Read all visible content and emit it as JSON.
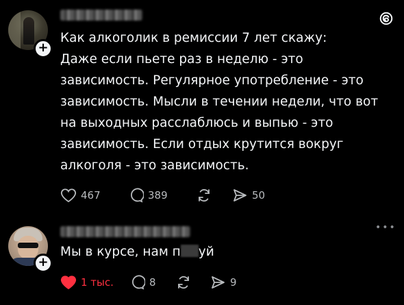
{
  "post1": {
    "author_obscured": true,
    "lines": [
      "Как алкоголик в ремиссии 7 лет скажу:",
      "Даже если пьете раз в неделю - это",
      "зависимость. Регулярное употребление - это",
      "зависимость. Мысли в течении недели, что вот",
      "на выходных расслаблюсь и выпью - это",
      "зависимость. Если отдых крутится вокруг",
      "алкоголя - это зависимость."
    ],
    "likes": "467",
    "comments": "389",
    "shares": "50"
  },
  "post2": {
    "author_obscured": true,
    "text_before": "Мы в курсе, нам п",
    "text_after": "уй",
    "likes": "1 тыс.",
    "comments": "8",
    "shares": "9",
    "liked": true
  },
  "colors": {
    "background": "#000000",
    "text": "#f3f5f7",
    "muted": "#b8bbbe",
    "like_active": "#ff3040"
  },
  "icons": [
    "threads-logo-icon",
    "heart-icon",
    "comment-icon",
    "repost-icon",
    "share-icon",
    "more-icon",
    "follow-plus-icon"
  ]
}
